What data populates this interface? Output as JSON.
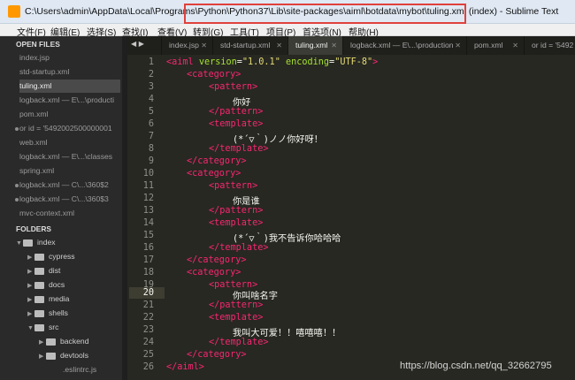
{
  "title": {
    "path": "C:\\Users\\admin\\AppData\\Local\\Programs\\Python\\Python37\\Lib\\site-packages\\aiml\\botdata\\mybot\\tuling.xml (index) - Sublime Text"
  },
  "menu": [
    "文件(F)",
    "编辑(E)",
    "选择(S)",
    "查找(I)",
    "查看(V)",
    "转到(G)",
    "工具(T)",
    "项目(P)",
    "首选项(N)",
    "帮助(H)"
  ],
  "sidebar": {
    "open_files_title": "OPEN FILES",
    "open_files": [
      "index.jsp",
      "std-startup.xml",
      "tuling.xml",
      "logback.xml — E\\...\\producti",
      "pom.xml",
      "or id = '5492002500000001",
      "web.xml",
      "logback.xml — E\\...\\classes",
      "spring.xml",
      "logback.xml — C\\...\\360$2",
      "logback.xml — C\\...\\360$3",
      "mvc-context.xml"
    ],
    "folders_title": "FOLDERS",
    "folders": [
      "index",
      "cypress",
      "dist",
      "docs",
      "media",
      "shells",
      "src",
      "backend",
      "devtools",
      ".eslintrc.js"
    ]
  },
  "tabs": [
    "index.jsp",
    "std-startup.xml",
    "tuling.xml",
    "logback.xml — E\\...\\production",
    "pom.xml",
    "or id = '5492"
  ],
  "code": {
    "line_numbers": [
      "1",
      "2",
      "3",
      "4",
      "5",
      "6",
      "7",
      "8",
      "9",
      "10",
      "11",
      "12",
      "13",
      "14",
      "15",
      "16",
      "17",
      "18",
      "19",
      "20",
      "21",
      "22",
      "23",
      "24",
      "25",
      "26"
    ],
    "xml_decl": [
      "<aiml",
      "version",
      "=",
      "\"1.0.1\"",
      "encoding",
      "=",
      "\"UTF-8\"",
      ">"
    ],
    "lines": {
      "category_open": "<category>",
      "pattern_open": "<pattern>",
      "pattern_close": "</pattern>",
      "template_open": "<template>",
      "template_close": "</template>",
      "category_close": "</category>",
      "aiml_close": "</aiml>"
    },
    "text_1": "你好",
    "text_2": "(*´▽｀)ノノ你好呀！",
    "text_3": "你是谁",
    "text_4": "(*´▽｀)我不告诉你哈哈哈",
    "text_5": "你叫啥名字",
    "text_6": "我叫大可爱！！嘻嘻嘻！！"
  },
  "watermark": "https://blog.csdn.net/qq_32662795",
  "colors": {
    "background": "#272822",
    "tag": "#f92672",
    "attribute": "#a6e22e",
    "string": "#e6db74",
    "highlight": "#e0413b"
  }
}
